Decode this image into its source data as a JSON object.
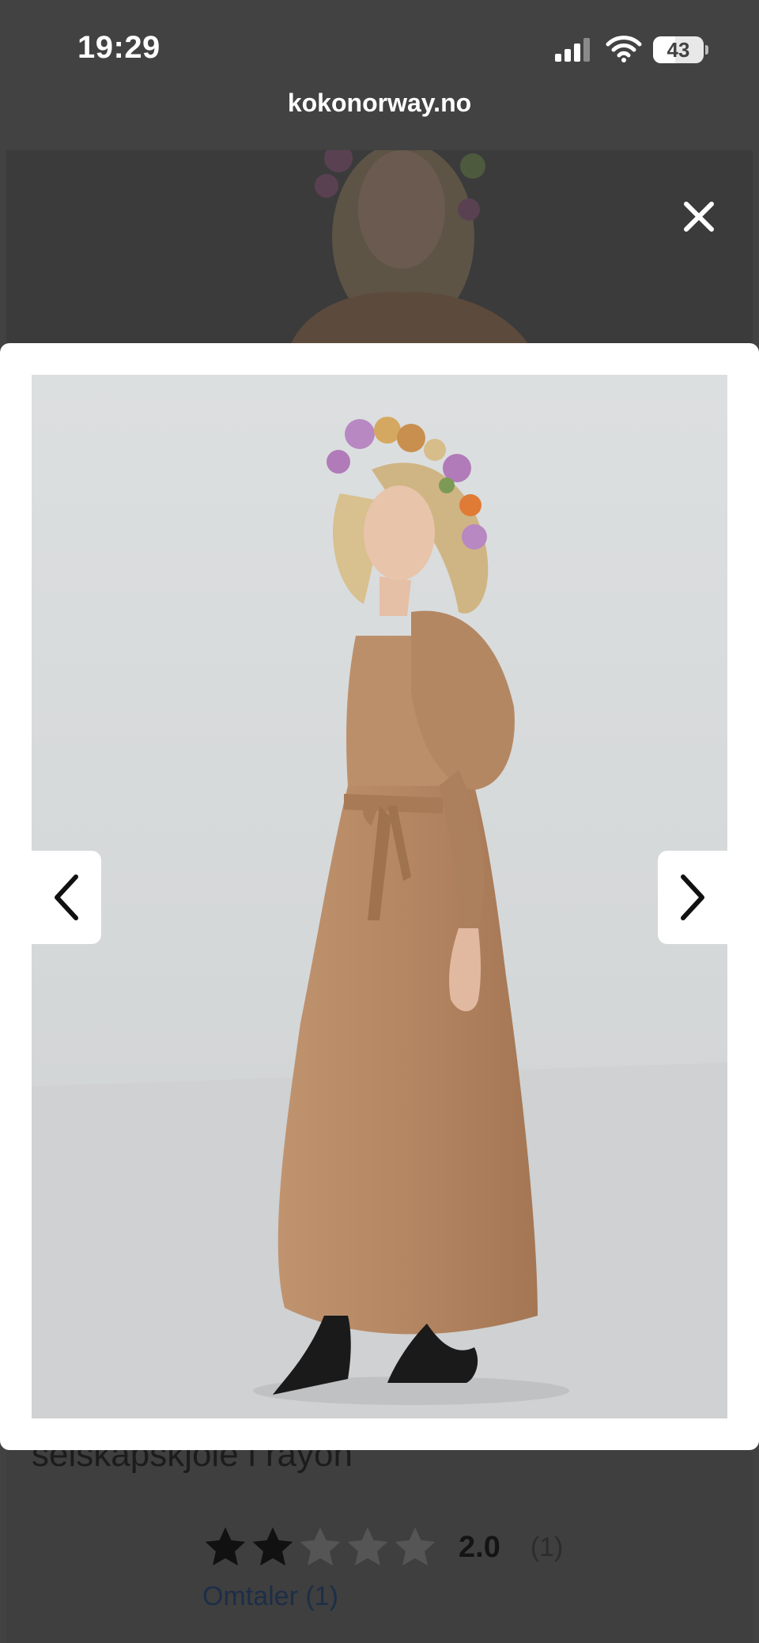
{
  "status_bar": {
    "time": "19:29",
    "battery_level": "43",
    "battery_fraction": 0.43,
    "signal_icon": "cellular-signal-icon",
    "wifi_icon": "wifi-icon"
  },
  "browser": {
    "url": "kokonorway.no"
  },
  "background_page": {
    "product_title": "selskapskjole i rayon",
    "rating": {
      "stars_filled": 2,
      "stars_total": 5,
      "value": "2.0",
      "count": "(1)"
    },
    "reviews_link": "Omtaler (1)"
  },
  "lightbox": {
    "close_icon": "close-icon",
    "prev_icon": "chevron-left-icon",
    "next_icon": "chevron-right-icon"
  },
  "colors": {
    "overlay": "#424242",
    "dress": "#b88b68",
    "studio_background": "#d9dcdd",
    "star_filled": "#111111",
    "star_empty": "#555555",
    "link": "#1d2e48"
  }
}
